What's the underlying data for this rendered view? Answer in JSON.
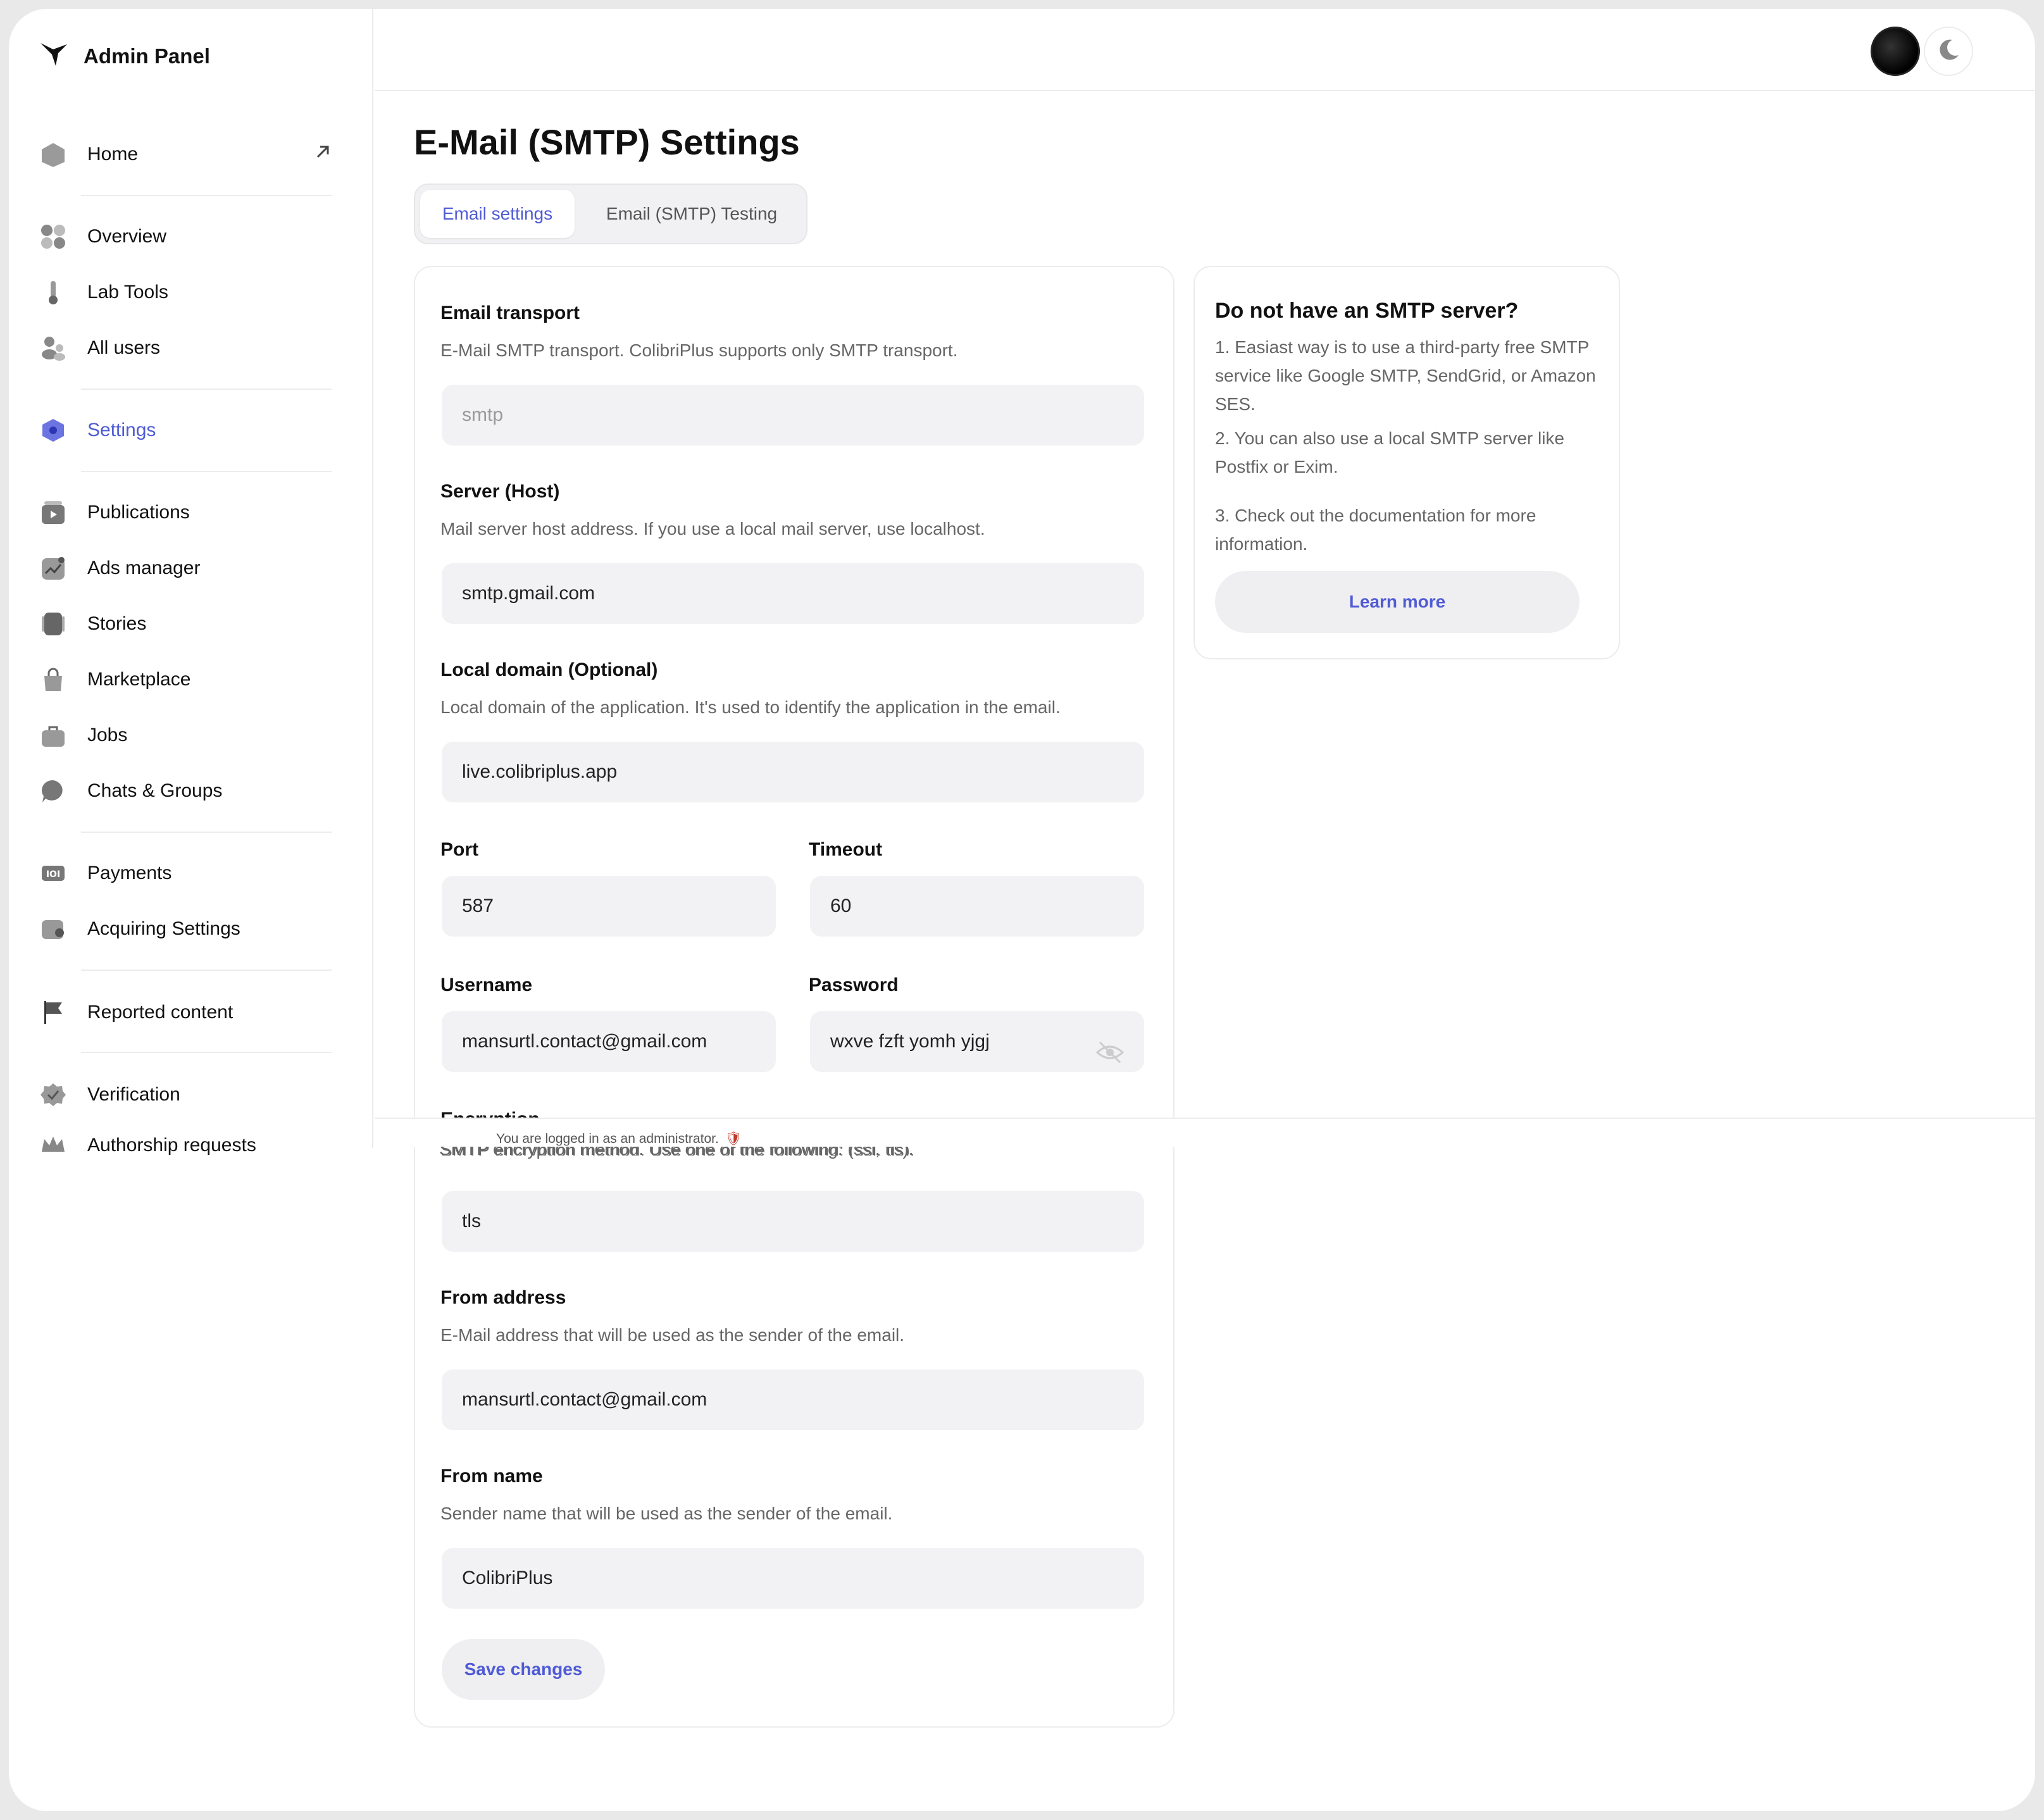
{
  "app": {
    "title": "Admin Panel"
  },
  "sidebar": {
    "items": [
      {
        "label": "Home"
      },
      {
        "label": "Overview"
      },
      {
        "label": "Lab Tools"
      },
      {
        "label": "All users"
      },
      {
        "label": "Settings"
      },
      {
        "label": "Publications"
      },
      {
        "label": "Ads manager"
      },
      {
        "label": "Stories"
      },
      {
        "label": "Marketplace"
      },
      {
        "label": "Jobs"
      },
      {
        "label": "Chats & Groups"
      },
      {
        "label": "Payments"
      },
      {
        "label": "Acquiring Settings"
      },
      {
        "label": "Reported content"
      },
      {
        "label": "Verification"
      },
      {
        "label": "Authorship requests"
      }
    ]
  },
  "page": {
    "title": "E-Mail (SMTP) Settings",
    "tabs": [
      {
        "label": "Email settings",
        "active": true
      },
      {
        "label": "Email (SMTP) Testing"
      }
    ]
  },
  "form": {
    "transport": {
      "label": "Email transport",
      "desc": "E-Mail SMTP transport. ColibriPlus supports only SMTP transport.",
      "value": "smtp"
    },
    "host": {
      "label": "Server (Host)",
      "desc": "Mail server host address. If you use a local mail server, use localhost.",
      "value": "smtp.gmail.com"
    },
    "domain": {
      "label": "Local domain (Optional)",
      "desc": "Local domain of the application. It's used to identify the application in the email.",
      "value": "live.colibriplus.app"
    },
    "port": {
      "label": "Port",
      "value": "587"
    },
    "timeout": {
      "label": "Timeout",
      "value": "60"
    },
    "username": {
      "label": "Username",
      "value": "mansurtl.contact@gmail.com"
    },
    "password": {
      "label": "Password",
      "value": "wxve fzft yomh yjgj"
    },
    "encryption": {
      "label": "Encryption",
      "desc": "SMTP encryption method. Use one of the following: (ssl, tls).",
      "value": "tls"
    },
    "from_address": {
      "label": "From address",
      "desc": "E-Mail address that will be used as the sender of the email.",
      "value": "mansurtl.contact@gmail.com"
    },
    "from_name": {
      "label": "From name",
      "desc": "Sender name that will be used as the sender of the email.",
      "value": "ColibriPlus"
    },
    "save_label": "Save changes"
  },
  "info_card": {
    "title": "Do not have an SMTP server?",
    "p1": "1. Easiast way is to use a third-party free SMTP service like Google SMTP, SendGrid, or Amazon SES.",
    "p2": "2. You can also use a local SMTP server like Postfix or Exim.",
    "p3": "3. Check out the documentation for more information.",
    "button": "Learn more"
  },
  "admin_notice": "You are logged in as an administrator.",
  "colors": {
    "accent": "#4f5bd5",
    "muted": "#666666",
    "input_bg": "#f2f2f4"
  }
}
